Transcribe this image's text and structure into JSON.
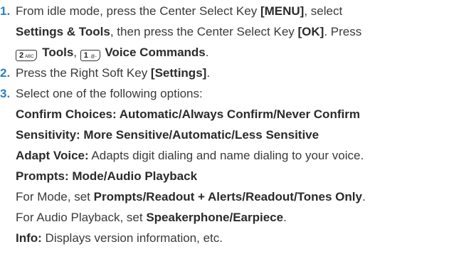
{
  "steps": [
    {
      "number": "1.",
      "line1": {
        "pre": "From idle mode, press the Center Select Key ",
        "key_menu": "[MENU]",
        "post": ", select"
      },
      "line2": {
        "settings": "Settings & Tools",
        "mid": ", then press the Center Select Key ",
        "key_ok": "[OK]",
        "post": ". Press"
      },
      "line3": {
        "key2_digit": "2",
        "key2_letters": "ABC",
        "tools": "Tools",
        "comma": ", ",
        "key1_digit": "1",
        "key1_letters": ".@-",
        "voice": "Voice Commands",
        "end": "."
      }
    },
    {
      "number": "2.",
      "pre": "Press the Right Soft Key ",
      "key": "[Settings]",
      "end": "."
    },
    {
      "number": "3.",
      "text": "Select one of the following options:"
    }
  ],
  "options": {
    "confirm": "Confirm Choices: Automatic/Always Confirm/Never Confirm",
    "sensitivity": "Sensitivity: More Sensitive/Automatic/Less Sensitive",
    "adapt_label": "Adapt Voice:",
    "adapt_text": " Adapts digit dialing and name dialing to your voice.",
    "prompts": "Prompts: Mode/Audio Playback",
    "mode_pre": "For Mode, set ",
    "mode_bold": "Prompts/Readout + Alerts/Readout/Tones Only",
    "mode_end": ".",
    "audio_pre": "For Audio Playback, set ",
    "audio_bold": "Speakerphone/Earpiece",
    "audio_end": ".",
    "info_label": "Info:",
    "info_text": " Displays version information, etc."
  }
}
